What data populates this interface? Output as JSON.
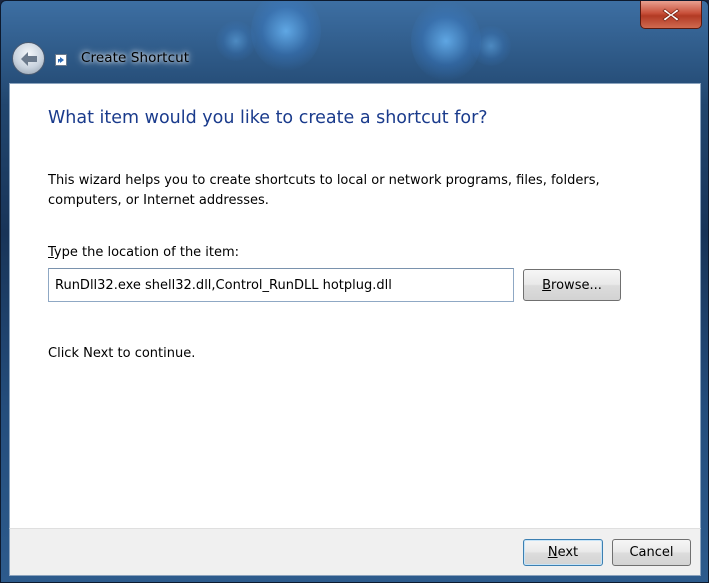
{
  "window": {
    "title": "Create Shortcut",
    "close_icon": "close-icon",
    "back_icon": "back-arrow-icon",
    "title_icon": "shortcut-icon",
    "accent_color": "#1a3b8c",
    "close_color": "#c8503a"
  },
  "page": {
    "heading": "What item would you like to create a shortcut for?",
    "description": "This wizard helps you to create shortcuts to local or network programs, files, folders, computers, or Internet addresses.",
    "location_label_accel": "T",
    "location_label_rest": "ype the location of the item:",
    "location_value": "RunDll32.exe shell32.dll,Control_RunDLL hotplug.dll",
    "browse_label_accel": "B",
    "browse_label_rest": "rowse...",
    "continue_text": "Click Next to continue."
  },
  "footer": {
    "next_accel": "N",
    "next_rest": "ext",
    "cancel_label": "Cancel"
  }
}
